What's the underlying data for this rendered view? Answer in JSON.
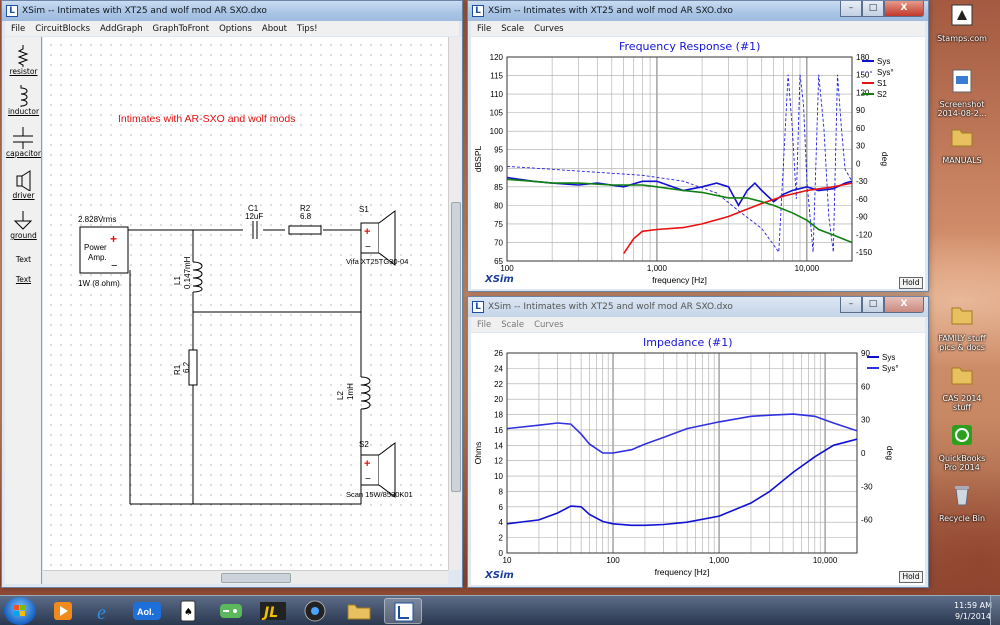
{
  "circuit_window": {
    "title": "XSim -- Intimates with XT25 and wolf mod AR SXO.dxo",
    "menu": [
      "File",
      "CircuitBlocks",
      "AddGraph",
      "GraphToFront",
      "Options",
      "About",
      "Tips!"
    ],
    "tools": [
      "resistor",
      "inductor",
      "capacitor",
      "driver",
      "ground",
      "Text",
      "Text"
    ],
    "heading": "Intimates with AR-SXO and wolf mods",
    "source": {
      "voltage": "2.828Vrms",
      "label_line1": "Power",
      "label_line2": "Amp.",
      "power": "1W (8 ohm)",
      "plus": "+",
      "minus": "−"
    },
    "parts": {
      "c1_name": "C1",
      "c1_value": "12uF",
      "r2_name": "R2",
      "r2_value": "6.8",
      "s1_name": "S1",
      "s1_model": "Vifa XT25TG30-04",
      "l1_name": "L1",
      "l1_value": "0.147mH",
      "r1_name": "R1",
      "r1_value": "6.2",
      "l2_name": "L2",
      "l2_value": "1mH",
      "s2_name": "S2",
      "s2_model": "Scan 15W/8530K01"
    }
  },
  "freq_window": {
    "title": "XSim -- Intimates with XT25 and wolf mod AR SXO.dxo",
    "menu": [
      "File",
      "Scale",
      "Curves"
    ],
    "graph_title": "Frequency Response (#1)",
    "ylabel": "dBSPL",
    "y2label": "deg",
    "xlabel": "frequency [Hz]",
    "brand": "XSim",
    "hold": "Hold"
  },
  "imp_window": {
    "title": "XSim -- Intimates with XT25 and wolf mod AR SXO.dxo",
    "menu": [
      "File",
      "Scale",
      "Curves"
    ],
    "graph_title": "Impedance (#1)",
    "ylabel": "Ohms",
    "y2label": "deg",
    "xlabel": "frequency [Hz]",
    "brand": "XSim",
    "hold": "Hold"
  },
  "window_buttons": {
    "min": "–",
    "max": "□",
    "close": "X"
  },
  "chart_data": [
    {
      "type": "line",
      "title": "Frequency Response (#1)",
      "xlabel": "frequency [Hz]",
      "ylabel": "dBSPL",
      "y2label": "deg",
      "xscale": "log",
      "xlim": [
        100,
        20000
      ],
      "ylim": [
        65,
        120
      ],
      "y2lim": [
        -165,
        180
      ],
      "x_ticks": [
        "100",
        "1,000",
        "10,000"
      ],
      "y_ticks": [
        "120",
        "115",
        "110",
        "105",
        "100",
        "95",
        "90",
        "85",
        "80",
        "75",
        "70",
        "65"
      ],
      "y2_ticks": [
        "180",
        "150",
        "120",
        "90",
        "60",
        "30",
        "0",
        "-30",
        "-60",
        "-90",
        "-120",
        "-150"
      ],
      "legend_position": "top-right",
      "series": [
        {
          "name": "Sys",
          "axis": "left",
          "color": "#1010d0",
          "style": "solid",
          "x": [
            100,
            150,
            200,
            300,
            400,
            600,
            800,
            1000,
            1500,
            2000,
            2500,
            3000,
            3500,
            4000,
            4500,
            5000,
            6000,
            7000,
            8000,
            10000,
            12000,
            15000,
            18000,
            20000
          ],
          "y": [
            87.5,
            86.5,
            86,
            85.5,
            86,
            85,
            86.5,
            86.5,
            84,
            85,
            86,
            85,
            80,
            84,
            86,
            84,
            81,
            83,
            84,
            85,
            84,
            84.5,
            86,
            86.5
          ]
        },
        {
          "name": "Sys°",
          "axis": "right",
          "color": "#2020e0",
          "style": "dashed",
          "x": [
            100,
            200,
            400,
            800,
            1500,
            2500,
            3500,
            5000,
            6500,
            7500,
            8000,
            8500,
            9000,
            9500,
            10000,
            11000,
            12000,
            13000,
            14000,
            15000,
            16000,
            17000,
            18000,
            20000
          ],
          "y": [
            -5,
            -10,
            -15,
            -20,
            -30,
            -50,
            -80,
            -110,
            -150,
            150,
            60,
            -60,
            150,
            100,
            -30,
            -150,
            150,
            60,
            -90,
            -150,
            150,
            60,
            -10,
            -30
          ]
        },
        {
          "name": "S1",
          "axis": "left",
          "color": "#e81010",
          "style": "solid",
          "x": [
            600,
            700,
            800,
            1000,
            1500,
            2000,
            3000,
            4000,
            5000,
            7000,
            10000,
            15000,
            20000
          ],
          "y": [
            67,
            71,
            73,
            73.5,
            74,
            75,
            77,
            79,
            80.5,
            82.5,
            84,
            85,
            86
          ]
        },
        {
          "name": "S2",
          "axis": "left",
          "color": "#108010",
          "style": "solid",
          "x": [
            100,
            150,
            200,
            300,
            500,
            800,
            1000,
            1500,
            2000,
            3000,
            4000,
            5000,
            6000,
            8000,
            10000,
            12000,
            15000,
            20000
          ],
          "y": [
            87,
            86.5,
            86,
            86,
            85.5,
            85.5,
            85,
            84,
            83.5,
            82,
            82,
            81,
            80,
            78,
            76,
            73.5,
            72,
            70
          ]
        }
      ]
    },
    {
      "type": "line",
      "title": "Impedance (#1)",
      "xlabel": "frequency [Hz]",
      "ylabel": "Ohms",
      "y2label": "deg",
      "xscale": "log",
      "xlim": [
        10,
        20000
      ],
      "ylim": [
        0,
        26
      ],
      "y2lim": [
        -90,
        90
      ],
      "x_ticks": [
        "10",
        "100",
        "1,000",
        "10,000"
      ],
      "y_ticks": [
        "26",
        "24",
        "22",
        "20",
        "18",
        "16",
        "14",
        "12",
        "10",
        "8",
        "6",
        "4",
        "2",
        "0"
      ],
      "y2_ticks": [
        "90",
        "60",
        "30",
        "0",
        "-30",
        "-60"
      ],
      "legend_position": "top-right",
      "series": [
        {
          "name": "Sys",
          "axis": "left",
          "color": "#1010d0",
          "style": "solid",
          "x": [
            10,
            20,
            30,
            40,
            50,
            60,
            80,
            100,
            150,
            200,
            300,
            500,
            1000,
            2000,
            3000,
            5000,
            8000,
            12000,
            20000
          ],
          "y": [
            3.8,
            4.3,
            5.2,
            6.1,
            6.0,
            5.0,
            4.1,
            3.8,
            3.6,
            3.6,
            3.7,
            4.0,
            4.8,
            6.5,
            8.0,
            10.5,
            12.5,
            14.0,
            14.8
          ]
        },
        {
          "name": "Sys°",
          "axis": "right",
          "color": "#3030e0",
          "style": "solid",
          "x": [
            10,
            20,
            30,
            40,
            50,
            60,
            80,
            100,
            150,
            200,
            300,
            500,
            1000,
            2000,
            3000,
            5000,
            8000,
            12000,
            20000
          ],
          "y": [
            22,
            25,
            27,
            26,
            17,
            8,
            0,
            0,
            3,
            8,
            14,
            22,
            28,
            33,
            34,
            35,
            33,
            27,
            20
          ]
        }
      ]
    }
  ],
  "desktop_icons": [
    {
      "label_line1": "Stamps.com",
      "label_line2": ""
    },
    {
      "label_line1": "Screenshot",
      "label_line2": "2014-08-2..."
    },
    {
      "label_line1": "MANUALS",
      "label_line2": ""
    },
    {
      "label_line1": "FAMILY stuff",
      "label_line2": "pics & docs"
    },
    {
      "label_line1": "CAS 2014",
      "label_line2": "stuff"
    },
    {
      "label_line1": "QuickBooks",
      "label_line2": "Pro 2014"
    },
    {
      "label_line1": "Recycle Bin",
      "label_line2": ""
    }
  ],
  "taskbar": {
    "apps": [
      "media-player",
      "internet-explorer",
      "aol",
      "solitaire",
      "games",
      "pdf-tool",
      "media-center",
      "file-explorer",
      "xsim"
    ],
    "aol_label": "Aol.",
    "time": "11:59 AM",
    "date": "9/1/2014"
  }
}
